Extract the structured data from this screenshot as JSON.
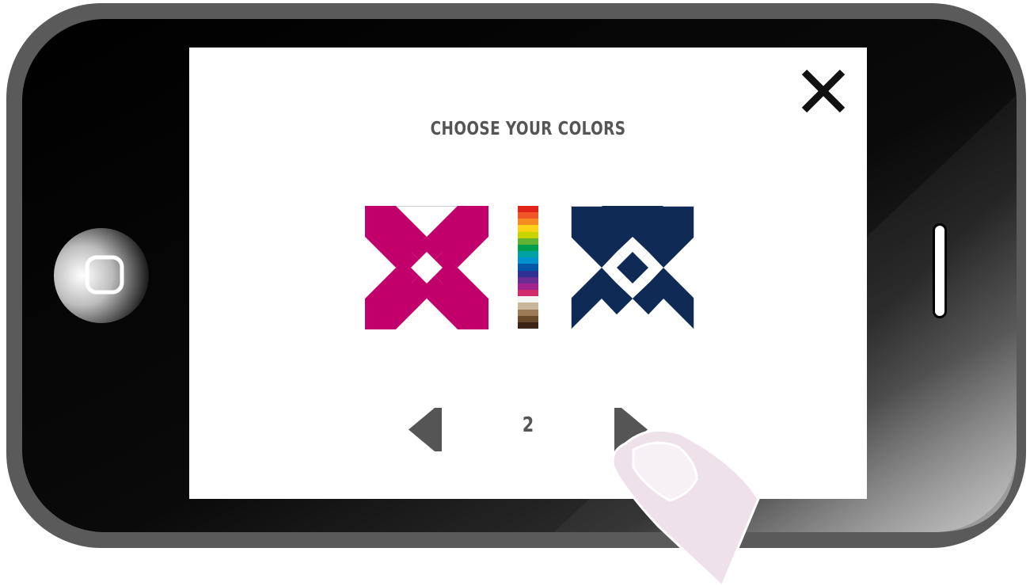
{
  "screen": {
    "title": "CHOOSE YOUR COLORS",
    "page_number": "2"
  },
  "icons": {
    "close": "close-icon",
    "prev": "triangle-left-icon",
    "next": "triangle-right-icon",
    "home": "home-button-icon"
  },
  "tiles": {
    "left_color": "#c2006b",
    "right_color": "#0e2a55"
  },
  "palette_colors": [
    "#e2231a",
    "#f0562a",
    "#f48b21",
    "#fcd116",
    "#c8d400",
    "#5fb233",
    "#009f4d",
    "#00a3a1",
    "#0093d0",
    "#0057a8",
    "#2e3192",
    "#6a2c91",
    "#a3238e",
    "#d12b6b",
    "#f4f4f4",
    "#c8b79b",
    "#9b7a55",
    "#6b4a2b",
    "#3b2416"
  ]
}
